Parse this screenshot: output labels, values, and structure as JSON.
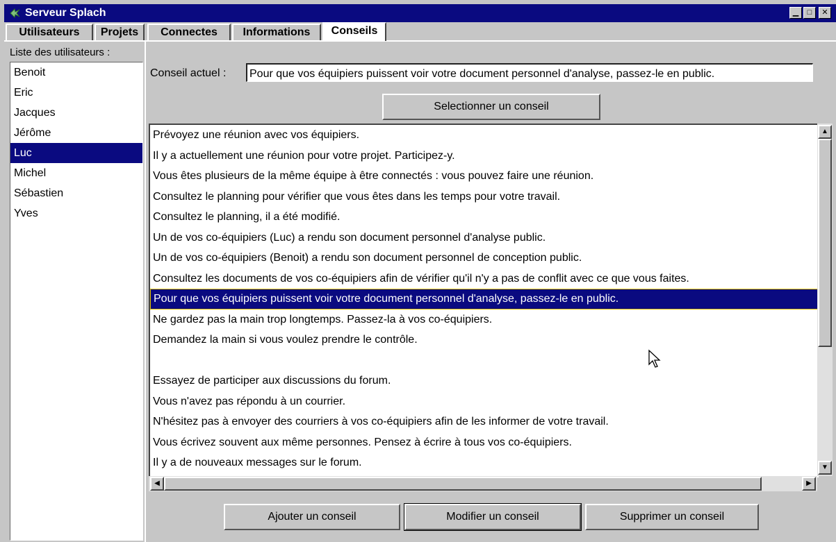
{
  "window": {
    "title": "Serveur Splach",
    "controls": {
      "minimize": "▁",
      "maximize": "□",
      "close": "✕"
    }
  },
  "tabs": [
    {
      "label": "Utilisateurs",
      "active": false
    },
    {
      "label": "Projets",
      "active": false
    },
    {
      "label": "Connectes",
      "active": false
    },
    {
      "label": "Informations",
      "active": false
    },
    {
      "label": "Conseils",
      "active": true
    }
  ],
  "users": {
    "label": "Liste des utilisateurs :",
    "items": [
      "Benoit",
      "Eric",
      "Jacques",
      "Jérôme",
      "Luc",
      "Michel",
      "Sébastien",
      "Yves"
    ],
    "selected": "Luc"
  },
  "current_advice": {
    "label": "Conseil actuel :",
    "value": "Pour que vos équipiers puissent voir votre document personnel d'analyse, passez-le en public."
  },
  "buttons": {
    "select": "Selectionner un conseil",
    "add": "Ajouter un conseil",
    "modify": "Modifier un conseil",
    "delete": "Supprimer un conseil"
  },
  "advice_list": {
    "items": [
      "Prévoyez une réunion avec vos équipiers.",
      "Il y a actuellement une réunion pour votre projet. Participez-y.",
      "Vous êtes plusieurs de la même équipe à être connectés : vous pouvez faire une réunion.",
      "Consultez le planning pour vérifier que vous êtes dans les temps pour votre travail.",
      "Consultez le planning, il a été modifié.",
      "Un de vos co-équipiers (Luc) a rendu son document personnel d'analyse public.",
      "Un de vos co-équipiers (Benoit) a rendu son document personnel de conception public.",
      "Consultez les documents de vos co-équipiers afin de vérifier qu'il n'y a pas de conflit avec ce que vous faites.",
      "Pour que vos équipiers puissent voir votre document personnel d'analyse, passez-le en public.",
      "Ne gardez pas la main trop longtemps. Passez-la à vos co-équipiers.",
      "Demandez la main si vous voulez prendre le contrôle.",
      "",
      "Essayez de participer aux discussions du forum.",
      "Vous n'avez pas répondu à un courrier.",
      "N'hésitez pas à envoyer des courriers à vos co-équipiers afin de les informer de votre travail.",
      "Vous écrivez souvent aux même personnes. Pensez à écrire à tous vos co-équipiers.",
      "Il y a de nouveaux messages sur le forum."
    ],
    "selected_index": 8
  },
  "colors": {
    "title_bar": "#0a0a80",
    "selection": "#0a0a80",
    "face": "#c6c6c6"
  }
}
